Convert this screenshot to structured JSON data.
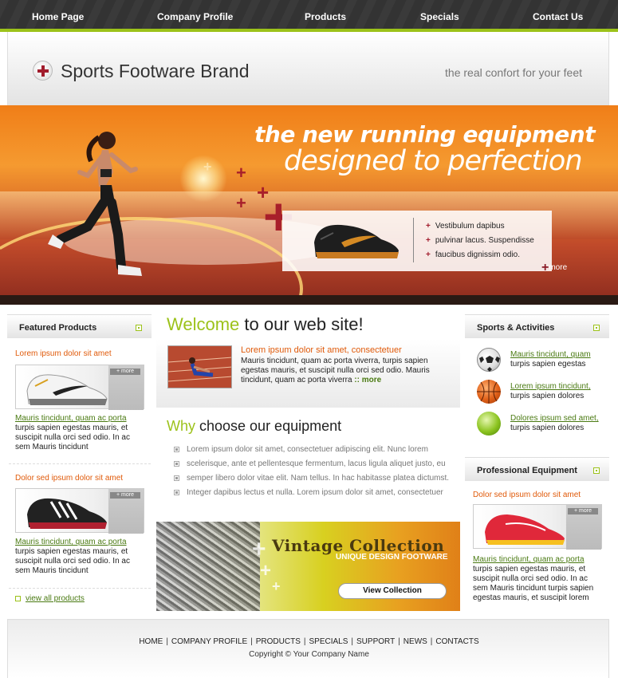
{
  "nav": {
    "items": [
      "Home Page",
      "Company Profile",
      "Products",
      "Specials",
      "Contact Us"
    ]
  },
  "header": {
    "brand": "Sports Footware Brand",
    "tagline": "the real confort for your feet"
  },
  "banner": {
    "headline1": "the new running equipment",
    "headline2": "designed to perfection",
    "features": [
      "Vestibulum dapibus",
      "pulvinar lacus. Suspendisse",
      "faucibus dignissim odio."
    ],
    "more": "more"
  },
  "featured": {
    "title": "Featured Products",
    "items": [
      {
        "title": "Lorem ipsum dolor sit amet",
        "more": "+ more",
        "link": "Mauris tincidunt, quam ac porta",
        "text": "turpis sapien egestas mauris, et suscipit nulla orci sed odio. In ac sem Mauris tincidunt"
      },
      {
        "title": "Dolor sed ipsum dolor sit amet",
        "more": "+ more",
        "link": "Mauris tincidunt, quam ac porta",
        "text": "turpis sapien egestas mauris, et suscipit nulla orci sed odio. In ac sem Mauris tincidunt"
      }
    ],
    "view_all": "view all products"
  },
  "welcome": {
    "highlight": "Welcome",
    "rest": " to our web site!",
    "intro_title": "Lorem ipsum dolor sit amet, consectetuer",
    "intro_text": "Mauris tincidunt, quam ac porta viverra, turpis sapien egestas mauris, et suscipit nulla orci sed odio. Mauris tincidunt, quam ac porta viverra",
    "intro_more": ":: more"
  },
  "why": {
    "highlight": "Why",
    "rest": " choose our equipment",
    "bullets": [
      "Lorem ipsum dolor sit amet, consectetuer adipiscing elit. Nunc lorem",
      "scelerisque, ante et pellentesque fermentum, lacus ligula aliquet justo, eu",
      "semper libero dolor vitae elit. Nam tellus. In hac habitasse platea dictumst.",
      "Integer dapibus lectus et nulla. Lorem ipsum dolor sit amet, consectetuer"
    ]
  },
  "vintage": {
    "title": "Vintage Collection",
    "subtitle": "UNIQUE DESIGN FOOTWARE",
    "button": "View Collection"
  },
  "sports": {
    "title": "Sports & Activities",
    "items": [
      {
        "link": "Mauris tincidunt, quam ",
        "text": "turpis sapien egestas",
        "icon": "soccer-ball-icon"
      },
      {
        "link": "Lorem ipsum tincidunt,",
        "text": "turpis sapien dolores",
        "icon": "basketball-icon"
      },
      {
        "link": "Dolores ipsum sed amet,",
        "text": "turpis sapien dolores",
        "icon": "green-ball-icon"
      }
    ]
  },
  "professional": {
    "title": "Professional Equipment",
    "item_title": "Dolor sed ipsum dolor sit amet",
    "more": "+ more",
    "link": "Mauris tincidunt, quam ac porta",
    "text": "turpis sapien egestas mauris, et suscipit nulla orci sed odio. In ac sem Mauris tincidunt turpis sapien egestas mauris, et suscipit lorem"
  },
  "footer": {
    "links": [
      "HOME",
      "COMPANY PROFILE",
      "PRODUCTS",
      "SPECIALS",
      "SUPPORT",
      "NEWS",
      "CONTACTS"
    ],
    "copyright": "Copyright © Your Company Name"
  },
  "colors": {
    "accent_green": "#9cc21a",
    "link_green": "#4a7a12",
    "title_orange": "#e05a0a",
    "cross_red": "#a11c2c"
  }
}
